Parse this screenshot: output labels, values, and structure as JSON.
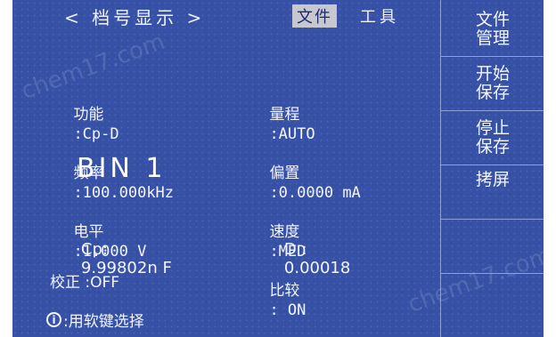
{
  "topbar": {
    "title": "< 档号显示 >",
    "tab_file": "文件",
    "tab_tools": "工具"
  },
  "params_left": [
    {
      "label": "功能",
      "value": ":Cp-D"
    },
    {
      "label": "频率",
      "value": ":100.000kHz"
    },
    {
      "label": "电平",
      "value": ":1.000 V"
    }
  ],
  "params_right": [
    {
      "label": "量程",
      "value": ":AUTO"
    },
    {
      "label": "偏置",
      "value": ":0.0000 mA"
    },
    {
      "label": "速度",
      "value": ":MED"
    },
    {
      "label": "比较",
      "value": ": ON"
    }
  ],
  "bin": "BIN 1",
  "measurement": {
    "cp_label": "Cp:",
    "cp_value": "9.99802n F",
    "d_label": "D :",
    "d_value": "0.00018"
  },
  "correction": "校正 :OFF",
  "hint": ":用软键选择",
  "softkeys": [
    {
      "line1": "文件",
      "line2": "管理"
    },
    {
      "line1": "开始",
      "line2": "保存"
    },
    {
      "line1": "停止",
      "line2": "保存"
    },
    {
      "line1": "拷屏",
      "line2": ""
    },
    {
      "line1": "",
      "line2": ""
    },
    {
      "line1": "",
      "line2": ""
    }
  ],
  "watermark": "chem17.com",
  "colors": {
    "screen_bg": "#3651a6",
    "text": "#f3f5ff",
    "tab_highlight": "#c7c7cf"
  },
  "icons": {
    "hint": "info-icon"
  }
}
